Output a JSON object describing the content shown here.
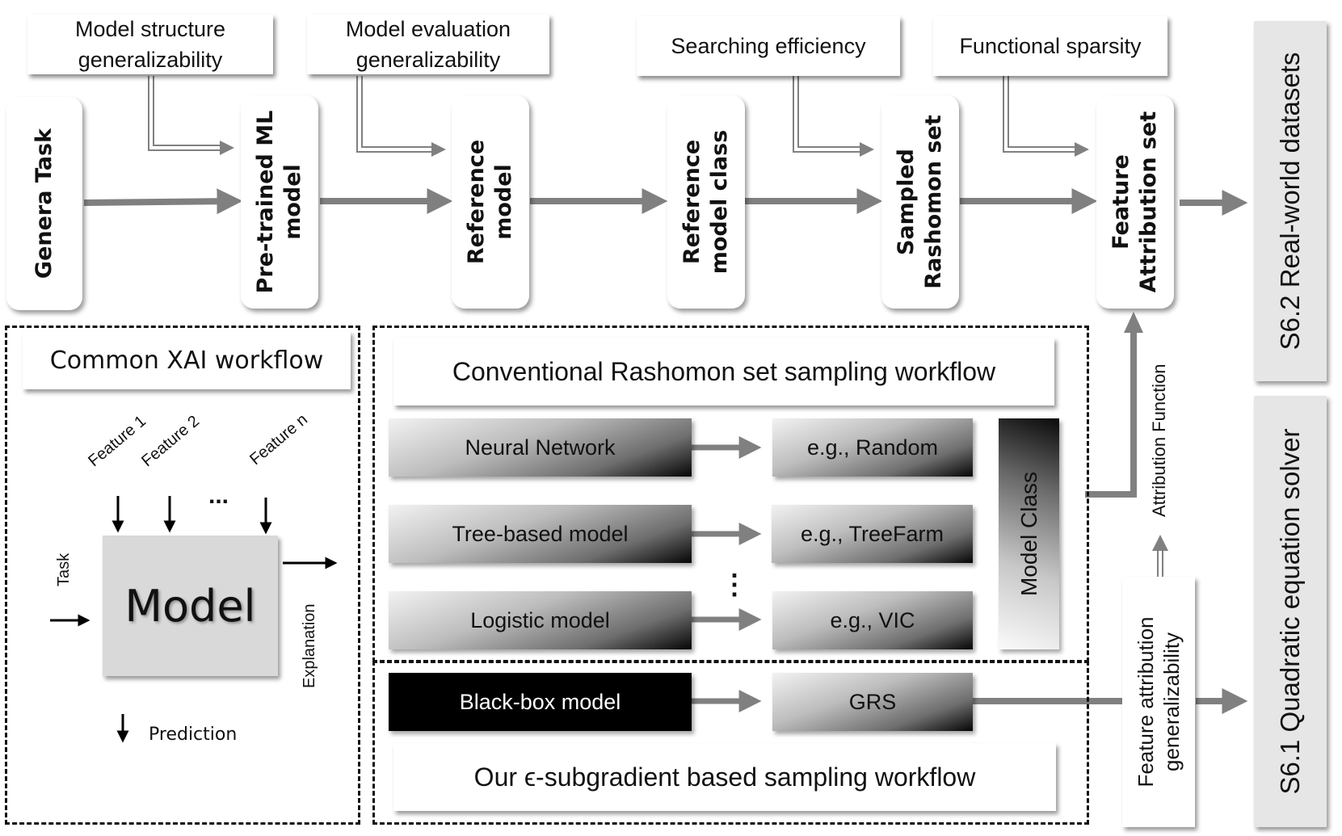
{
  "top_row": {
    "callouts": [
      {
        "id": "model-structure",
        "text": "Model structure\ngeneralizability"
      },
      {
        "id": "model-evaluation",
        "text": "Model evaluation\ngeneralizability"
      },
      {
        "id": "searching-efficiency",
        "text": "Searching efficiency"
      },
      {
        "id": "functional-sparsity",
        "text": "Functional sparsity"
      }
    ],
    "stages": [
      {
        "id": "general-task",
        "text": "Genera Task"
      },
      {
        "id": "pretrained-ml-model",
        "text": "Pre-trained ML\nmodel"
      },
      {
        "id": "reference-model",
        "text": "Reference\nmodel"
      },
      {
        "id": "reference-model-class",
        "text": "Reference\nmodel class"
      },
      {
        "id": "sampled-rashomon-set",
        "text": "Sampled\nRashomon set"
      },
      {
        "id": "feature-attribution-set",
        "text": "Feature\nAttribution set"
      }
    ]
  },
  "sections": {
    "real_world": "S6.2 Real-world datasets",
    "quadratic": "S6.1 Quadratic equation solver"
  },
  "xai": {
    "title": "Common XAI workflow",
    "model": "Model",
    "features": [
      "Feature 1",
      "Feature 2",
      "Feature n"
    ],
    "ellipsis": "...",
    "task": "Task",
    "prediction": "Prediction",
    "explanation": "Explanation"
  },
  "conventional": {
    "title": "Conventional Rashomon set sampling workflow",
    "rows": [
      {
        "model": "Neural Network",
        "method": "e.g., Random"
      },
      {
        "model": "Tree-based model",
        "method": "e.g., TreeFarm"
      },
      {
        "model": "Logistic model",
        "method": "e.g., VIC"
      }
    ],
    "vellipsis": "⋮",
    "model_class": "Model Class"
  },
  "ours": {
    "model": "Black-box model",
    "method": "GRS",
    "title": "Our ϵ-subgradient based sampling workflow"
  },
  "right_side": {
    "attribution_function": "Attribution Function",
    "feature_attribution_generalizability": "Feature attribution\ngeneralizability"
  },
  "colors": {
    "arrow": "#808080",
    "section_bg": "#e6e6e6",
    "model_box": "#d9d9d9"
  }
}
